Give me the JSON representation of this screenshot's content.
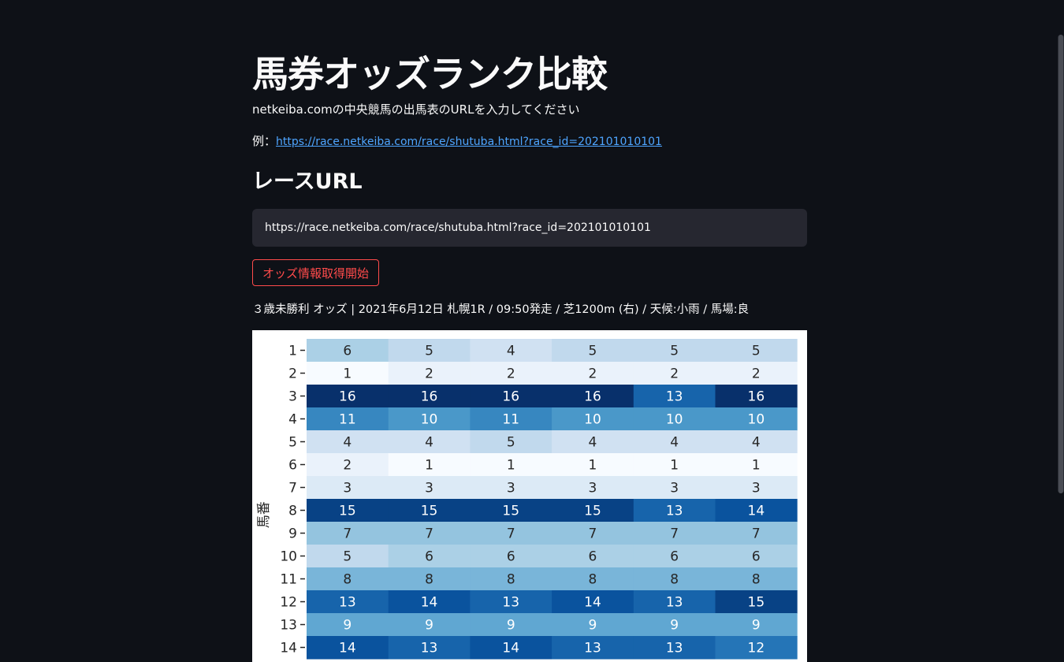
{
  "page": {
    "title": "馬券オッズランク比較",
    "description": "netkeiba.comの中央競馬の出馬表のURLを入力してください",
    "example_prefix": "例：",
    "example_link": "https://race.netkeiba.com/race/shutuba.html?race_id=202101010101"
  },
  "form": {
    "section_title": "レースURL",
    "url_value": "https://race.netkeiba.com/race/shutuba.html?race_id=202101010101",
    "submit_label": "オッズ情報取得開始"
  },
  "race_info": "３歳未勝利 オッズ | 2021年6月12日 札幌1R / 09:50発走 / 芝1200m (右) / 天候:小雨 / 馬場:良",
  "chart_data": {
    "type": "heatmap",
    "ylabel": "馬番",
    "rows": [
      "1",
      "2",
      "3",
      "4",
      "5",
      "6",
      "7",
      "8",
      "9",
      "10",
      "11",
      "12",
      "13",
      "14"
    ],
    "columns": 6,
    "values": [
      [
        6,
        5,
        4,
        5,
        5,
        5
      ],
      [
        1,
        2,
        2,
        2,
        2,
        2
      ],
      [
        16,
        16,
        16,
        16,
        13,
        16
      ],
      [
        11,
        10,
        11,
        10,
        10,
        10
      ],
      [
        4,
        4,
        5,
        4,
        4,
        4
      ],
      [
        2,
        1,
        1,
        1,
        1,
        1
      ],
      [
        3,
        3,
        3,
        3,
        3,
        3
      ],
      [
        15,
        15,
        15,
        15,
        13,
        14
      ],
      [
        7,
        7,
        7,
        7,
        7,
        7
      ],
      [
        5,
        6,
        6,
        6,
        6,
        6
      ],
      [
        8,
        8,
        8,
        8,
        8,
        8
      ],
      [
        13,
        14,
        13,
        14,
        13,
        15
      ],
      [
        9,
        9,
        9,
        9,
        9,
        9
      ],
      [
        14,
        13,
        14,
        13,
        13,
        12
      ]
    ],
    "colormap": "Blues",
    "vmin": 1,
    "vmax": 16
  }
}
